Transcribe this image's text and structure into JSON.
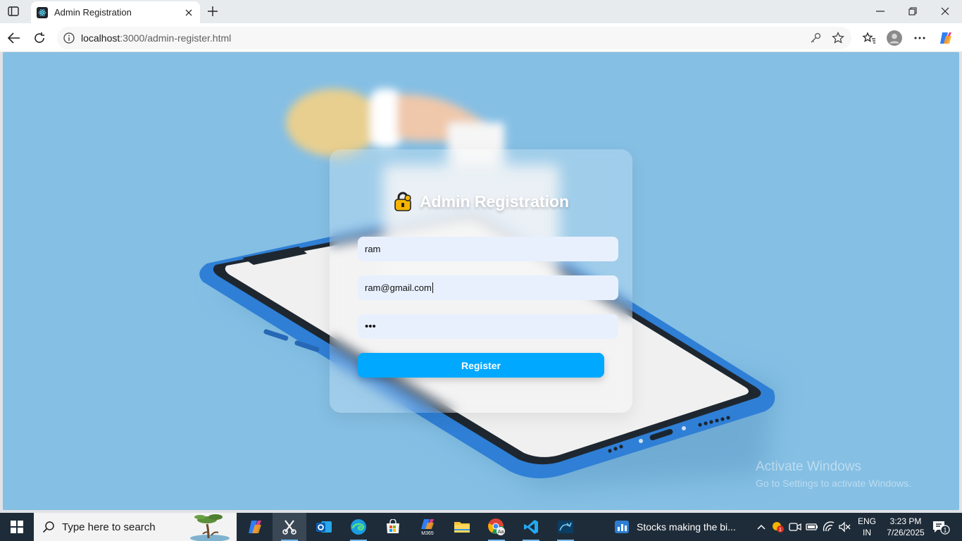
{
  "browser": {
    "tab_title": "Admin Registration",
    "url_host": "localhost",
    "url_rest": ":3000/admin-register.html"
  },
  "page": {
    "heading": "Admin Registration",
    "name_value": "ram",
    "email_value": "ram@gmail.com",
    "password_mask": "•••",
    "register_label": "Register",
    "watermark_line1": "Activate Windows",
    "watermark_line2": "Go to Settings to activate Windows."
  },
  "taskbar": {
    "search_placeholder": "Type here to search",
    "news_text": "Stocks making the bi...",
    "lang_top": "ENG",
    "lang_bottom": "IN",
    "time": "3:23 PM",
    "date": "7/26/2025",
    "notification_count": "1",
    "tray_alert_count": "1",
    "app_badge": "M365"
  },
  "colors": {
    "page_background": "#85bfe4",
    "register_button": "#00a8ff",
    "input_background": "#e8f0fe",
    "phone_frame": "#2f7fd6"
  }
}
